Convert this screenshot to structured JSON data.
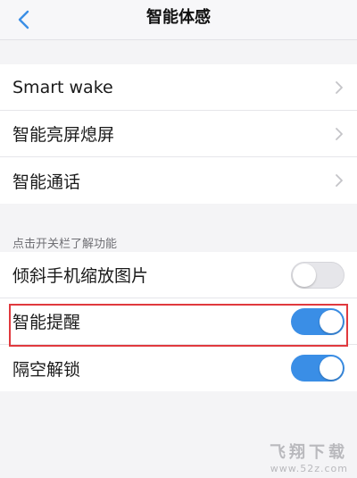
{
  "header": {
    "title": "智能体感",
    "back_icon": "chevron-left-icon"
  },
  "group1": {
    "items": [
      {
        "label": "Smart wake"
      },
      {
        "label": "智能亮屏熄屏"
      },
      {
        "label": "智能通话"
      }
    ]
  },
  "section2": {
    "header": "点击开关栏了解功能",
    "items": [
      {
        "label": "倾斜手机缩放图片",
        "enabled": false
      },
      {
        "label": "智能提醒",
        "enabled": true
      },
      {
        "label": "隔空解锁",
        "enabled": true
      }
    ]
  },
  "colors": {
    "accent": "#3a8ee6",
    "highlight": "#e0393e"
  },
  "watermark": {
    "text": "飞翔下载",
    "url": "www.52z.com"
  }
}
